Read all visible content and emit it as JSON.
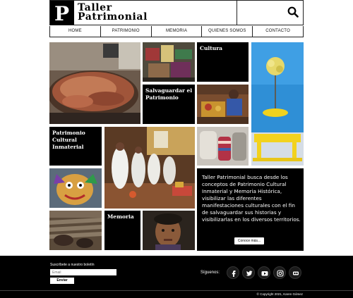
{
  "header": {
    "logo_letter": "P",
    "brand_line1": "Taller",
    "brand_line2": "Patrimonial"
  },
  "nav": {
    "items": [
      "HOME",
      "PATRIMONIO",
      "MEMORIA",
      "QUIENES SOMOS",
      "CONTACTO"
    ]
  },
  "tiles": {
    "cultura": "Cultura",
    "salvaguardar": "Salvaguardar el Patrimonio",
    "patrimonio_inmaterial": "Patrimonio Cultural Inmaterial",
    "memoria": "Memoria"
  },
  "about": {
    "text": "Taller Patrimonial busca desde los conceptos de Patrimonio Cultural Inmaterial y Memoria Histórica, visibilizar las diferentes manifestaciones culturales con el fin de salvaguardar sus historias y visibilizarlas en los diversos territorios.",
    "button": "Conoce más..."
  },
  "footer": {
    "newsletter_label": "Suscríbete a nuestro boletín",
    "email_placeholder": "Email",
    "send_button": "Enviar",
    "follow_label": "Síguenos:",
    "social_icons": [
      "facebook-icon",
      "twitter-icon",
      "youtube-icon",
      "instagram-icon",
      "flickr-icon"
    ],
    "copyright": "© Copyright 2021, Karen Gómez"
  },
  "colors": {
    "background": "#ffffff",
    "tile_black": "#000000",
    "footer": "#000000",
    "photo_blue": "#2f8fd6",
    "photo_yellow": "#f2d21e"
  }
}
